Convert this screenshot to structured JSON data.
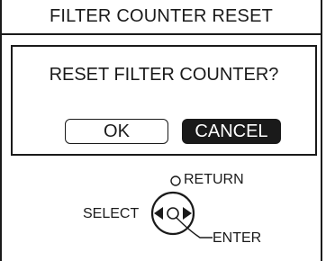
{
  "header": {
    "title": "FILTER COUNTER RESET"
  },
  "dialog": {
    "message": "RESET FILTER COUNTER?",
    "ok_label": "OK",
    "cancel_label": "CANCEL"
  },
  "controls": {
    "return_label": "RETURN",
    "select_label": "SELECT",
    "enter_label": "ENTER"
  }
}
